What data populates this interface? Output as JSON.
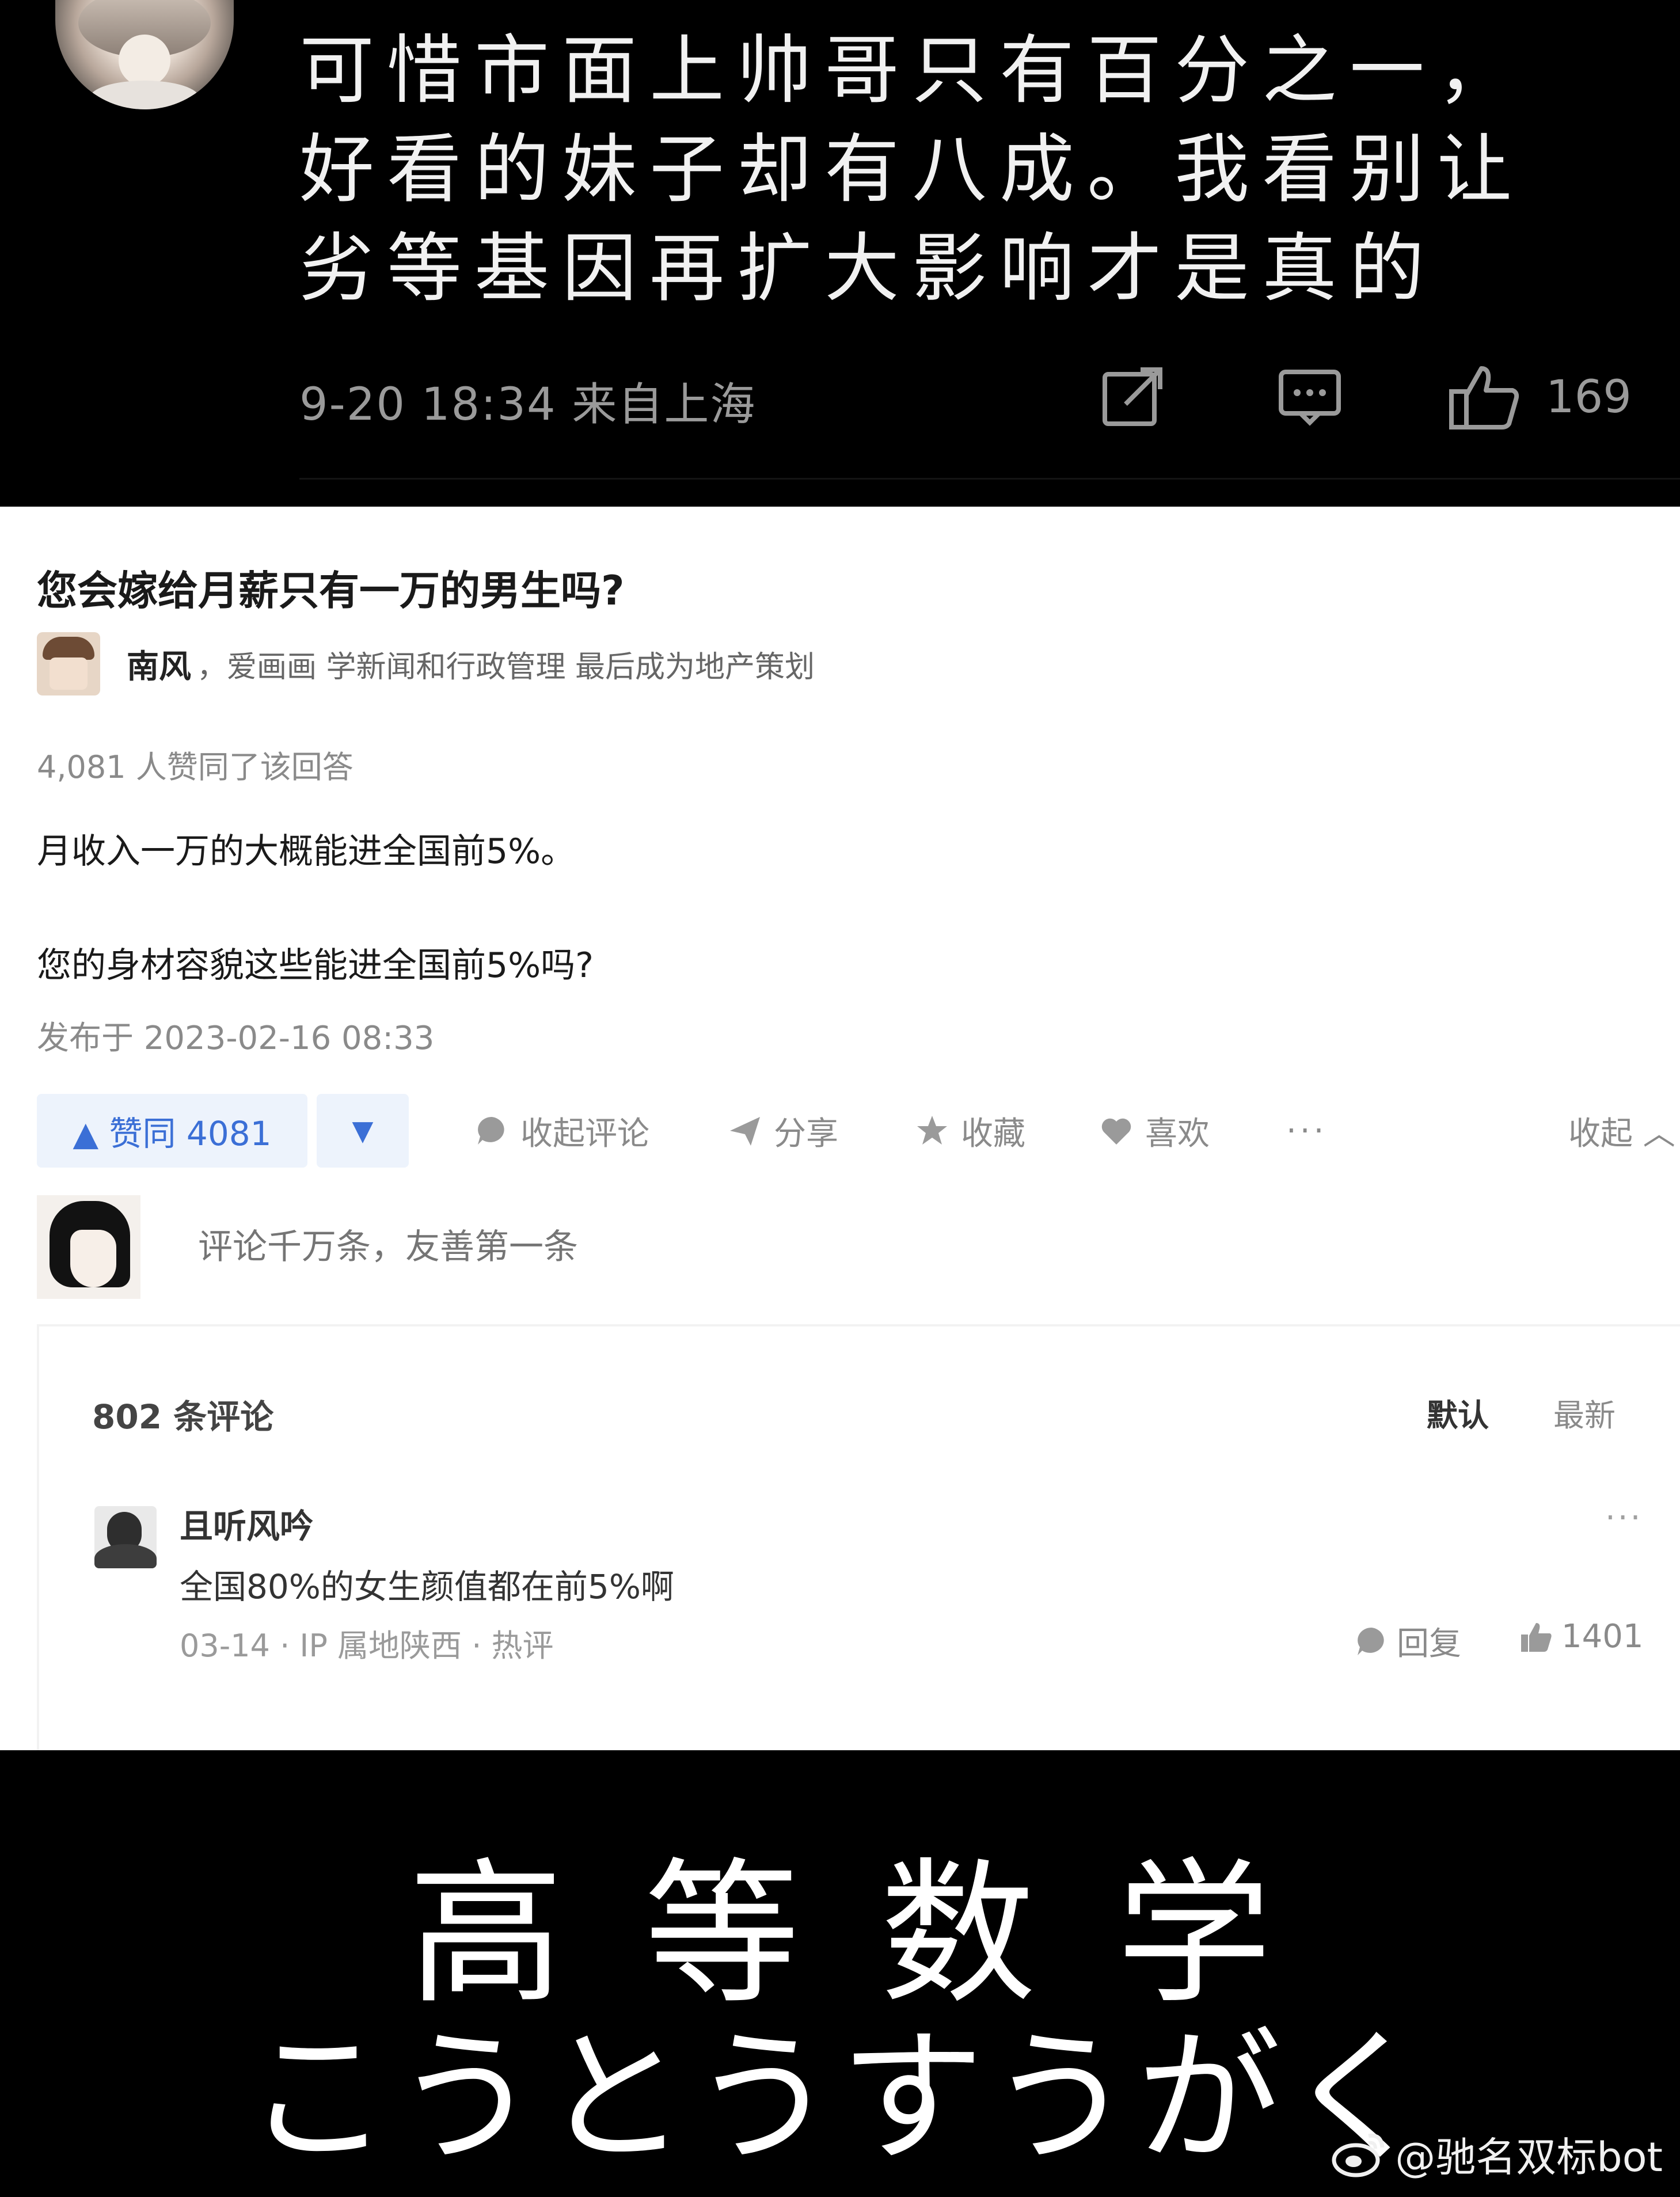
{
  "top_comment": {
    "text": "可惜市面上帅哥只有百分之一，好看的妹子却有八成。我看别让劣等基因再扩大影响才是真的",
    "date": "9-20  18:34  来自上海",
    "like_count": "169",
    "icons": [
      "avatar",
      "share-icon",
      "comment-icon",
      "thumbs-up-icon"
    ]
  },
  "zhihu": {
    "question": "您会嫁给月薪只有一万的男生吗?",
    "author_name": "南风",
    "author_bio": "，爱画画 学新闻和行政管理 最后成为地产策划",
    "votes_line": "4,081 人赞同了该回答",
    "body1": "月收入一万的大概能进全国前5%。",
    "body2": "您的身材容貌这些能进全国前5%吗?",
    "published": "发布于 2023-02-16 08:33",
    "actions": {
      "vote_up": "▲ 赞同 4081",
      "vote_down": "▼",
      "comments": "收起评论",
      "share": "分享",
      "favorite": "收藏",
      "like": "喜欢",
      "more": "···",
      "collapse": "收起 ︿"
    },
    "comment_placeholder": "评论千万条，友善第一条",
    "comments_panel": {
      "count": "802 条评论",
      "sort_default": "默认",
      "sort_new": "最新",
      "comment": {
        "name": "且听风吟",
        "text": "全国80%的女生颜值都在前5%啊",
        "meta": "03-14 · IP 属地陕西 · 热评",
        "reply": "回复",
        "likes": "1401",
        "more": "···"
      }
    }
  },
  "caption": {
    "kanji": "高等数学",
    "kana": "こうとうすうがく",
    "watermark": "@驰名双标bot"
  }
}
